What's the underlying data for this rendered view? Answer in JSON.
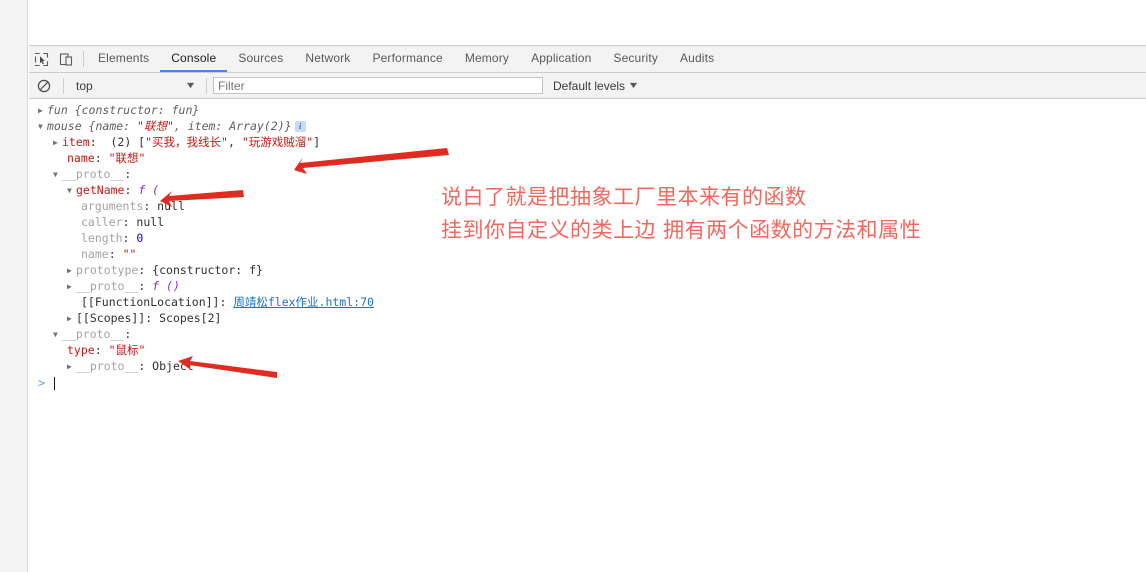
{
  "window": {
    "blank_page_area": ""
  },
  "devtools": {
    "toolbar": {
      "inspect_icon": "inspect-element-icon",
      "device_icon": "device-toolbar-icon",
      "tabs": [
        {
          "label": "Elements",
          "active": false
        },
        {
          "label": "Console",
          "active": true
        },
        {
          "label": "Sources",
          "active": false
        },
        {
          "label": "Network",
          "active": false
        },
        {
          "label": "Performance",
          "active": false
        },
        {
          "label": "Memory",
          "active": false
        },
        {
          "label": "Application",
          "active": false
        },
        {
          "label": "Security",
          "active": false
        },
        {
          "label": "Audits",
          "active": false
        }
      ]
    },
    "filterbar": {
      "clear_icon": "clear-console-icon",
      "context_value": "top",
      "context_caret": "▼",
      "filter_placeholder": "Filter",
      "filter_value": "",
      "levels_label": "Default levels",
      "levels_caret": "▼"
    },
    "console": {
      "lines": {
        "l1_head": "fun {constructor: fun}",
        "l2_name": "mouse",
        "l2_head": " {name: ",
        "l2_name_val": "\"联想\"",
        "l2_head2": ", item: Array(2)}",
        "l2_badge": "i",
        "l3_key": "item",
        "l3_count": " (2) [",
        "l3_v1": "\"买我，我线长\"",
        "l3_comma": ", ",
        "l3_v2": "\"玩游戏贼溜\"",
        "l3_close": "]",
        "l4_key": "name",
        "l4_val": "\"联想\"",
        "l5_key": "__proto__",
        "l6_key": "getName",
        "l6_val": "f (",
        "l7_key": "arguments",
        "l7_val": "null",
        "l8_key": "caller",
        "l8_val": "null",
        "l9_key": "length",
        "l9_val": "0",
        "l10_key": "name",
        "l10_val": "\"\"",
        "l11_key": "prototype",
        "l11_val": "{constructor: f}",
        "l12_key": "__proto__",
        "l12_val": "f ()",
        "l13_key": "[[FunctionLocation]]",
        "l13_link": "周靖松flex作业.html:70",
        "l14_key": "[[Scopes]]",
        "l14_val": "Scopes[2]",
        "l15_key": "__proto__",
        "l16_key": "type",
        "l16_val": "\"鼠标\"",
        "l17_key": "__proto__",
        "l17_val": "Object"
      },
      "prompt_caret": ">",
      "prompt_value": ""
    }
  },
  "annotations": {
    "color": "#f2685e",
    "note_line1": "说白了就是把抽象工厂里本来有的函数",
    "note_line2": "挂到你自定义的类上边 拥有两个函数的方法和属性",
    "arrows": [
      {
        "name": "arrow-to-item-array"
      },
      {
        "name": "arrow-to-getname"
      },
      {
        "name": "arrow-to-type"
      }
    ]
  }
}
